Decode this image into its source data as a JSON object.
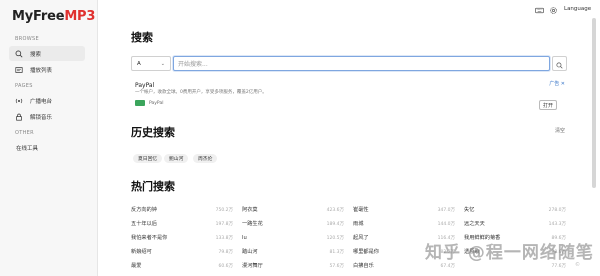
{
  "app": {
    "logo_main": "MyFree",
    "logo_accent": "MP3",
    "accent_color": "#e0312f"
  },
  "sidebar": {
    "browse_label": "BROWSE",
    "pages_label": "PAGES",
    "other_label": "OTHER",
    "items": [
      {
        "label": "搜索",
        "icon": "search-icon",
        "active": true
      },
      {
        "label": "播放列表",
        "icon": "playlist-icon",
        "active": false
      },
      {
        "label": "广播电台",
        "icon": "radio-icon",
        "active": false
      },
      {
        "label": "解锁音乐",
        "icon": "lock-icon",
        "active": false
      },
      {
        "label": "在线工具",
        "icon": "",
        "active": false
      }
    ]
  },
  "topbar": {
    "keyboard_icon": "keyboard-icon",
    "settings_icon": "gear-icon",
    "language_label": "Language"
  },
  "search": {
    "heading": "搜索",
    "source_value": "A",
    "placeholder": "开始搜索...",
    "button_icon": "search-icon"
  },
  "ad": {
    "title": "PayPal",
    "label": "广告 ✕",
    "description": "一个帐户，收款全球。0费用开户，享受多项服务，覆盖2亿用户。",
    "brand": "PayPal",
    "open_label": "打开"
  },
  "history": {
    "heading": "历史搜索",
    "clear_label": "清空",
    "items": [
      "夏日回忆",
      "鲍山河",
      "周杰伦"
    ]
  },
  "hot": {
    "heading": "热门搜索",
    "rows": [
      [
        {
          "name": "反方向的钟",
          "count": "750.2万"
        },
        {
          "name": "阿衣莫",
          "count": "423.6万"
        },
        {
          "name": "崔毫性",
          "count": "347.0万"
        },
        {
          "name": "失忆",
          "count": "278.0万"
        }
      ],
      [
        {
          "name": "五十年以后",
          "count": "197.8万"
        },
        {
          "name": "一路生花",
          "count": "189.4万"
        },
        {
          "name": "雨城",
          "count": "144.0万"
        },
        {
          "name": "远之天天",
          "count": "143.3万"
        }
      ],
      [
        {
          "name": "我怕来者不是你",
          "count": "133.8万"
        },
        {
          "name": "lu",
          "count": "120.5万"
        },
        {
          "name": "起风了",
          "count": "116.4万"
        },
        {
          "name": "我用鲜鲜的菊香",
          "count": "89.6万"
        }
      ],
      [
        {
          "name": "新娘绍可",
          "count": "79.8万"
        },
        {
          "name": "踏山河",
          "count": "81.3万"
        },
        {
          "name": "哪里都是你",
          "count": "82.7万"
        },
        {
          "name": "透原歌",
          "count": "78.6万"
        }
      ],
      [
        {
          "name": "最爱",
          "count": "60.6万"
        },
        {
          "name": "漫河舞厅",
          "count": "57.6万"
        },
        {
          "name": "白拂自乐",
          "count": "67.4万"
        },
        {
          "name": "",
          "count": "77.6万"
        }
      ]
    ]
  },
  "watermark": {
    "text": "知乎 @程一网络随笔",
    "sub": "©"
  }
}
